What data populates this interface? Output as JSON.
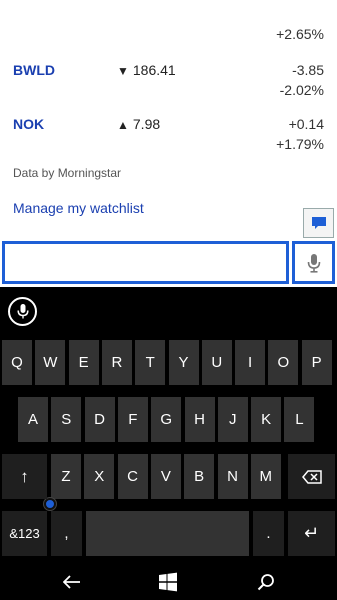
{
  "watchlist": {
    "top_percent": "+2.65%",
    "stocks": [
      {
        "symbol": "BWLD",
        "direction": "down",
        "arrow": "▼",
        "price": "186.41",
        "change": "-3.85",
        "percent": "-2.02%"
      },
      {
        "symbol": "NOK",
        "direction": "up",
        "arrow": "▲",
        "price": "7.98",
        "change": "+0.14",
        "percent": "+1.79%"
      }
    ],
    "credit": "Data by Morningstar",
    "manage_link": "Manage my watchlist"
  },
  "chat_button": {
    "icon": "chat-bubble-icon",
    "color": "#1e5fd6"
  },
  "input": {
    "value": "",
    "placeholder": "",
    "mic_icon": "microphone-icon"
  },
  "keyboard": {
    "row1": [
      "Q",
      "W",
      "E",
      "R",
      "T",
      "Y",
      "U",
      "I",
      "O",
      "P"
    ],
    "row2": [
      "A",
      "S",
      "D",
      "F",
      "G",
      "H",
      "J",
      "K",
      "L"
    ],
    "row3": [
      "Z",
      "X",
      "C",
      "V",
      "B",
      "N",
      "M"
    ],
    "shift_label": "↑",
    "numbers_label": "&123",
    "comma_label": ",",
    "period_label": ".",
    "enter_label": "↵",
    "backspace_icon": "backspace-icon",
    "voice_icon": "microphone-icon"
  },
  "navbar": {
    "back_icon": "back-arrow-icon",
    "start_icon": "windows-logo-icon",
    "search_icon": "search-icon"
  },
  "colors": {
    "accent": "#1e5fd6",
    "link": "#1a3fb0",
    "key": "#333333",
    "key_dark": "#1f1f1f"
  }
}
